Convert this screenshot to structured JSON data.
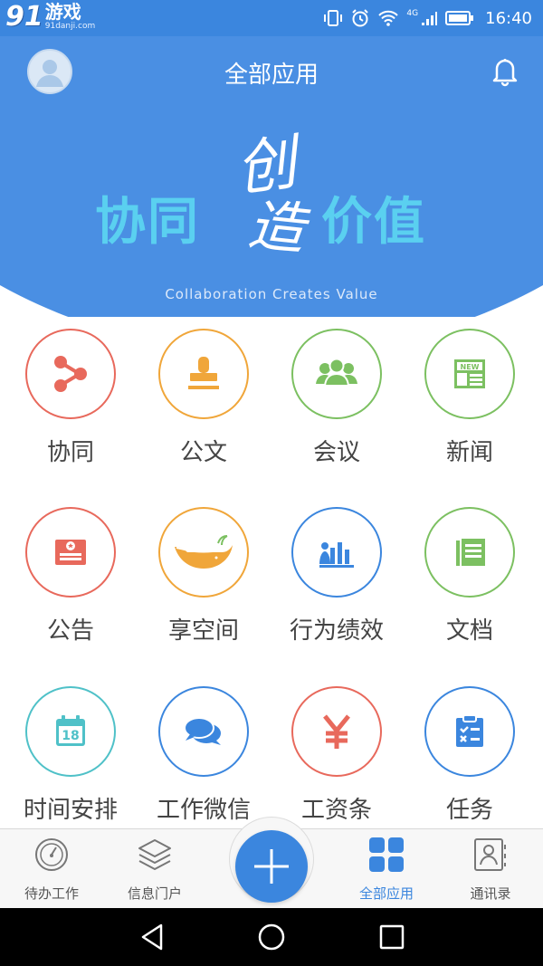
{
  "status_bar": {
    "watermark_number": "91",
    "watermark_text": "游戏",
    "watermark_url": "91danji.com",
    "network": "4G",
    "time": "16:40"
  },
  "header": {
    "title": "全部应用",
    "slogan_left": "协同",
    "slogan_center_top": "创",
    "slogan_center_bottom": "造",
    "slogan_right": "价值",
    "tagline": "Collaboration Creates Value"
  },
  "apps": [
    {
      "label": "协同",
      "icon": "share-nodes-icon",
      "color": "#e8695c"
    },
    {
      "label": "公文",
      "icon": "stamp-icon",
      "color": "#f0a63a"
    },
    {
      "label": "会议",
      "icon": "people-icon",
      "color": "#7cc061"
    },
    {
      "label": "新闻",
      "icon": "newspaper-icon",
      "color": "#7cc061"
    },
    {
      "label": "公告",
      "icon": "announcement-icon",
      "color": "#e8695c"
    },
    {
      "label": "享空间",
      "icon": "whale-icon",
      "color": "#f0a63a"
    },
    {
      "label": "行为绩效",
      "icon": "bar-chart-icon",
      "color": "#3b86de"
    },
    {
      "label": "文档",
      "icon": "document-icon",
      "color": "#7cc061"
    },
    {
      "label": "时间安排",
      "icon": "calendar-icon",
      "color": "#4fc1c8",
      "calendar_day": "18"
    },
    {
      "label": "工作微信",
      "icon": "chat-bubbles-icon",
      "color": "#3b86de"
    },
    {
      "label": "工资条",
      "icon": "yen-icon",
      "color": "#e8695c"
    },
    {
      "label": "任务",
      "icon": "clipboard-icon",
      "color": "#3b86de"
    }
  ],
  "bottom_tabs": [
    {
      "label": "待办工作",
      "icon": "gauge-icon",
      "active": false
    },
    {
      "label": "信息门户",
      "icon": "layers-icon",
      "active": false
    },
    {
      "label": "全部应用",
      "icon": "grid-icon",
      "active": true
    },
    {
      "label": "通讯录",
      "icon": "contacts-icon",
      "active": false
    }
  ],
  "fab": {
    "icon": "plus-icon"
  },
  "colors": {
    "primary": "#3b86de",
    "header": "#4a8fe3",
    "slogan": "#5ad0f0"
  }
}
